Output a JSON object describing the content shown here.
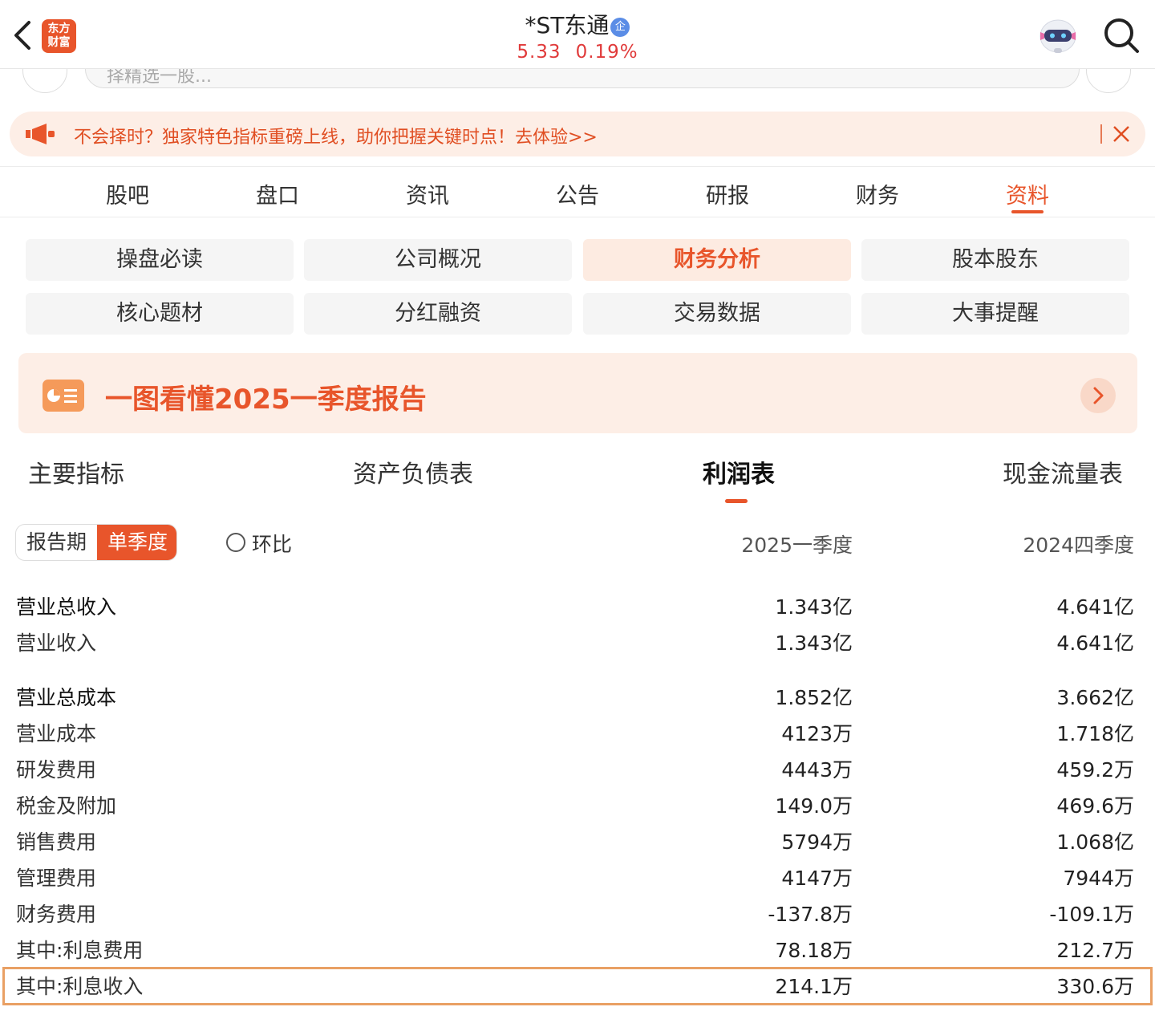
{
  "header": {
    "logo_line1": "东方",
    "logo_line2": "财富",
    "stock_name": "*ST东通",
    "badge": "企",
    "price": "5.33",
    "change_pct": "0.19%"
  },
  "search": {
    "placeholder_partial": "择精选一股..."
  },
  "banner": {
    "text": "不会择时？独家特色指标重磅上线，助你把握关键时点！去体验>>"
  },
  "top_nav": [
    "股吧",
    "盘口",
    "资讯",
    "公告",
    "研报",
    "财务",
    "资料"
  ],
  "top_nav_active": "资料",
  "grid": [
    [
      "操盘必读",
      "公司概况",
      "财务分析",
      "股本股东"
    ],
    [
      "核心题材",
      "分红融资",
      "交易数据",
      "大事提醒"
    ]
  ],
  "grid_active": "财务分析",
  "report_card": {
    "title": "一图看懂2025一季度报告"
  },
  "sub_tabs": [
    "主要指标",
    "资产负债表",
    "利润表",
    "现金流量表"
  ],
  "sub_tab_active": "利润表",
  "toggle": {
    "opt1": "报告期",
    "opt2": "单季度"
  },
  "radio_label": "环比",
  "columns": [
    "2025一季度",
    "2024四季度"
  ],
  "rows": [
    {
      "label": "营业总收入",
      "v1": "1.343亿",
      "v2": "4.641亿",
      "group": true
    },
    {
      "label": "营业收入",
      "v1": "1.343亿",
      "v2": "4.641亿"
    },
    {
      "label": "营业总成本",
      "v1": "1.852亿",
      "v2": "3.662亿",
      "group": true
    },
    {
      "label": "营业成本",
      "v1": "4123万",
      "v2": "1.718亿"
    },
    {
      "label": "研发费用",
      "v1": "4443万",
      "v2": "459.2万"
    },
    {
      "label": "税金及附加",
      "v1": "149.0万",
      "v2": "469.6万"
    },
    {
      "label": "销售费用",
      "v1": "5794万",
      "v2": "1.068亿"
    },
    {
      "label": "管理费用",
      "v1": "4147万",
      "v2": "7944万"
    },
    {
      "label": "财务费用",
      "v1": "-137.8万",
      "v2": "-109.1万"
    },
    {
      "label": "其中:利息费用",
      "v1": "78.18万",
      "v2": "212.7万"
    },
    {
      "label": "其中:利息收入",
      "v1": "214.1万",
      "v2": "330.6万"
    }
  ],
  "colors": {
    "accent": "#e8552b",
    "up": "#e03a3a",
    "highlight_border": "#e9a064"
  }
}
